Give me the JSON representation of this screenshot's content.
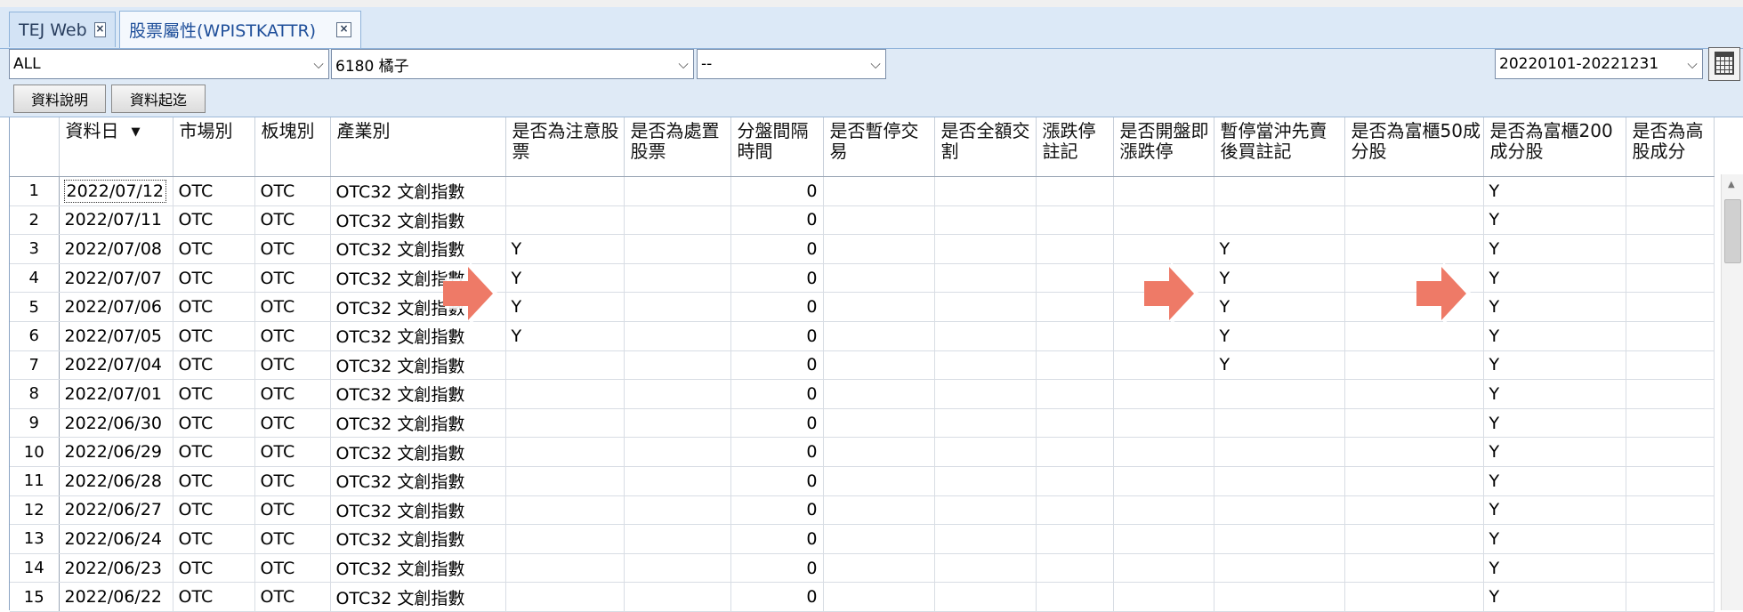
{
  "tabs": [
    {
      "label": "TEJ Web",
      "close": "×"
    },
    {
      "label": "股票屬性(WPISTKATTR)",
      "close": "×"
    }
  ],
  "filters": {
    "market": "ALL",
    "stock": "6180 橘子",
    "other": "--",
    "date_range": "20220101-20221231"
  },
  "buttons": {
    "data_description": "資料說明",
    "data_range": "資料起迄"
  },
  "columns": [
    "資料日",
    "市場別",
    "板塊別",
    "產業別",
    "是否為注意股票",
    "是否為處置股票",
    "分盤間隔時間",
    "是否暫停交易",
    "是否全額交割",
    "漲跌停註記",
    "是否開盤即漲跌停",
    "暫停當沖先賣後買註記",
    "是否為富櫃50成分股",
    "是否為富櫃200成分股",
    "是否為高股成分"
  ],
  "rows": [
    {
      "n": "1",
      "date": "2022/07/12",
      "market": "OTC",
      "board": "OTC",
      "industry": "OTC32 文創指數",
      "attention": "",
      "disposal": "",
      "interval": "0",
      "suspend": "",
      "fullpay": "",
      "limit": "",
      "openlimit": "",
      "daytrade": "",
      "f50": "",
      "f200": "Y",
      "hi": ""
    },
    {
      "n": "2",
      "date": "2022/07/11",
      "market": "OTC",
      "board": "OTC",
      "industry": "OTC32 文創指數",
      "attention": "",
      "disposal": "",
      "interval": "0",
      "suspend": "",
      "fullpay": "",
      "limit": "",
      "openlimit": "",
      "daytrade": "",
      "f50": "",
      "f200": "Y",
      "hi": ""
    },
    {
      "n": "3",
      "date": "2022/07/08",
      "market": "OTC",
      "board": "OTC",
      "industry": "OTC32 文創指數",
      "attention": "Y",
      "disposal": "",
      "interval": "0",
      "suspend": "",
      "fullpay": "",
      "limit": "",
      "openlimit": "",
      "daytrade": "Y",
      "f50": "",
      "f200": "Y",
      "hi": ""
    },
    {
      "n": "4",
      "date": "2022/07/07",
      "market": "OTC",
      "board": "OTC",
      "industry": "OTC32 文創指數",
      "attention": "Y",
      "disposal": "",
      "interval": "0",
      "suspend": "",
      "fullpay": "",
      "limit": "",
      "openlimit": "",
      "daytrade": "Y",
      "f50": "",
      "f200": "Y",
      "hi": ""
    },
    {
      "n": "5",
      "date": "2022/07/06",
      "market": "OTC",
      "board": "OTC",
      "industry": "OTC32 文創指數",
      "attention": "Y",
      "disposal": "",
      "interval": "0",
      "suspend": "",
      "fullpay": "",
      "limit": "",
      "openlimit": "",
      "daytrade": "Y",
      "f50": "",
      "f200": "Y",
      "hi": ""
    },
    {
      "n": "6",
      "date": "2022/07/05",
      "market": "OTC",
      "board": "OTC",
      "industry": "OTC32 文創指數",
      "attention": "Y",
      "disposal": "",
      "interval": "0",
      "suspend": "",
      "fullpay": "",
      "limit": "",
      "openlimit": "",
      "daytrade": "Y",
      "f50": "",
      "f200": "Y",
      "hi": ""
    },
    {
      "n": "7",
      "date": "2022/07/04",
      "market": "OTC",
      "board": "OTC",
      "industry": "OTC32 文創指數",
      "attention": "",
      "disposal": "",
      "interval": "0",
      "suspend": "",
      "fullpay": "",
      "limit": "",
      "openlimit": "",
      "daytrade": "Y",
      "f50": "",
      "f200": "Y",
      "hi": ""
    },
    {
      "n": "8",
      "date": "2022/07/01",
      "market": "OTC",
      "board": "OTC",
      "industry": "OTC32 文創指數",
      "attention": "",
      "disposal": "",
      "interval": "0",
      "suspend": "",
      "fullpay": "",
      "limit": "",
      "openlimit": "",
      "daytrade": "",
      "f50": "",
      "f200": "Y",
      "hi": ""
    },
    {
      "n": "9",
      "date": "2022/06/30",
      "market": "OTC",
      "board": "OTC",
      "industry": "OTC32 文創指數",
      "attention": "",
      "disposal": "",
      "interval": "0",
      "suspend": "",
      "fullpay": "",
      "limit": "",
      "openlimit": "",
      "daytrade": "",
      "f50": "",
      "f200": "Y",
      "hi": ""
    },
    {
      "n": "10",
      "date": "2022/06/29",
      "market": "OTC",
      "board": "OTC",
      "industry": "OTC32 文創指數",
      "attention": "",
      "disposal": "",
      "interval": "0",
      "suspend": "",
      "fullpay": "",
      "limit": "",
      "openlimit": "",
      "daytrade": "",
      "f50": "",
      "f200": "Y",
      "hi": ""
    },
    {
      "n": "11",
      "date": "2022/06/28",
      "market": "OTC",
      "board": "OTC",
      "industry": "OTC32 文創指數",
      "attention": "",
      "disposal": "",
      "interval": "0",
      "suspend": "",
      "fullpay": "",
      "limit": "",
      "openlimit": "",
      "daytrade": "",
      "f50": "",
      "f200": "Y",
      "hi": ""
    },
    {
      "n": "12",
      "date": "2022/06/27",
      "market": "OTC",
      "board": "OTC",
      "industry": "OTC32 文創指數",
      "attention": "",
      "disposal": "",
      "interval": "0",
      "suspend": "",
      "fullpay": "",
      "limit": "",
      "openlimit": "",
      "daytrade": "",
      "f50": "",
      "f200": "Y",
      "hi": ""
    },
    {
      "n": "13",
      "date": "2022/06/24",
      "market": "OTC",
      "board": "OTC",
      "industry": "OTC32 文創指數",
      "attention": "",
      "disposal": "",
      "interval": "0",
      "suspend": "",
      "fullpay": "",
      "limit": "",
      "openlimit": "",
      "daytrade": "",
      "f50": "",
      "f200": "Y",
      "hi": ""
    },
    {
      "n": "14",
      "date": "2022/06/23",
      "market": "OTC",
      "board": "OTC",
      "industry": "OTC32 文創指數",
      "attention": "",
      "disposal": "",
      "interval": "0",
      "suspend": "",
      "fullpay": "",
      "limit": "",
      "openlimit": "",
      "daytrade": "",
      "f50": "",
      "f200": "Y",
      "hi": ""
    },
    {
      "n": "15",
      "date": "2022/06/22",
      "market": "OTC",
      "board": "OTC",
      "industry": "OTC32 文創指數",
      "attention": "",
      "disposal": "",
      "interval": "0",
      "suspend": "",
      "fullpay": "",
      "limit": "",
      "openlimit": "",
      "daytrade": "",
      "f50": "",
      "f200": "Y",
      "hi": ""
    }
  ],
  "colors": {
    "arrow": "#ee7a67",
    "tab_bar": "#dce9f7",
    "toolbar": "#dfeaf6"
  },
  "icons": {
    "sort": "sort-desc-icon",
    "calendar": "calendar-icon",
    "arrow": "right-arrow-icon"
  }
}
